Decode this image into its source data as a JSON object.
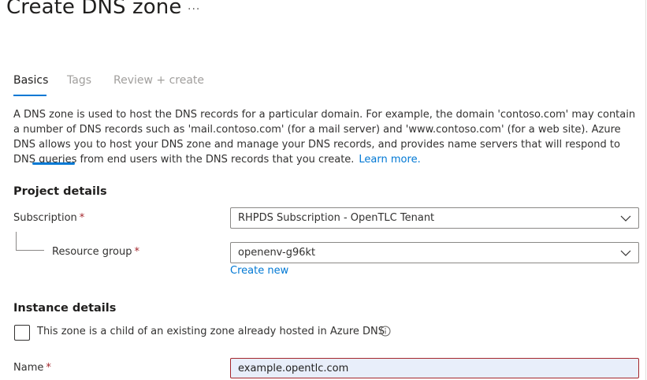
{
  "header": {
    "title": "Create DNS zone",
    "more_label": "···"
  },
  "tabs": [
    {
      "label": "Basics",
      "active": true
    },
    {
      "label": "Tags",
      "active": false
    },
    {
      "label": "Review + create",
      "active": false
    }
  ],
  "description": {
    "text": "A DNS zone is used to host the DNS records for a particular domain. For example, the domain 'contoso.com' may contain a number of DNS records such as 'mail.contoso.com' (for a mail server) and 'www.contoso.com' (for a web site). Azure DNS allows you to host your DNS zone and manage your DNS records, and provides name servers that will respond to DNS queries from end users with the DNS records that you create.",
    "learn_more": "Learn more."
  },
  "project_details": {
    "title": "Project details",
    "subscription": {
      "label": "Subscription",
      "required_mark": "*",
      "value": "RHPDS Subscription - OpenTLC Tenant"
    },
    "resource_group": {
      "label": "Resource group",
      "required_mark": "*",
      "value": "openenv-g96kt",
      "create_new": "Create new"
    }
  },
  "instance_details": {
    "title": "Instance details",
    "child_zone": {
      "label": "This zone is a child of an existing zone already hosted in Azure DNS",
      "checked": false
    },
    "name": {
      "label": "Name",
      "required_mark": "*",
      "value": "example.opentlc.com"
    }
  },
  "colors": {
    "accent": "#0078d4",
    "error": "#a4262c",
    "autofill": "#e8eefa"
  },
  "icons": [
    "chevron-down-icon",
    "info-icon"
  ]
}
